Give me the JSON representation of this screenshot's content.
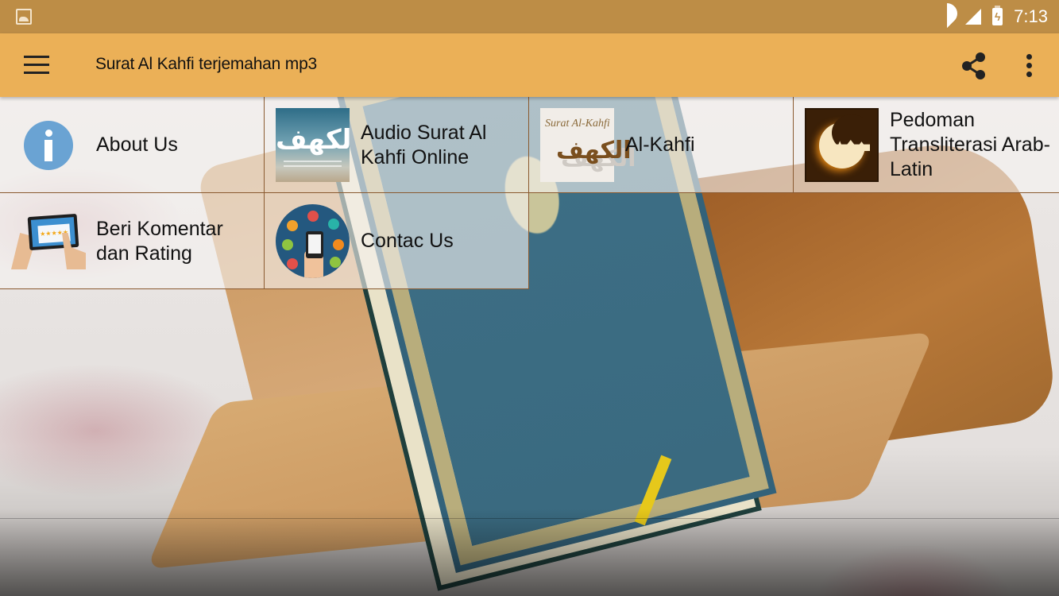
{
  "status_bar": {
    "time": "7:13",
    "icons": [
      "gallery-icon",
      "wifi-icon",
      "signal-icon",
      "battery-charging-icon"
    ]
  },
  "app_bar": {
    "title": "Surat Al Kahfi terjemahan mp3",
    "menu_icon": "hamburger-menu-icon",
    "share_icon": "share-icon",
    "more_icon": "more-vertical-icon"
  },
  "colors": {
    "status_bar": "#bd8d46",
    "app_bar": "#ebb057",
    "tile_border": "#8a5a30",
    "info_icon": "#6aa3d3"
  },
  "menu": {
    "items": [
      {
        "label": "About Us",
        "icon": "info-icon"
      },
      {
        "label": "Audio Surat Al Kahfi Online",
        "icon": "al-kahfi-calligraphy-thumbnail"
      },
      {
        "label": "Al-Kahfi",
        "icon": "surat-al-kahfi-thumbnail",
        "thumb_text": "Surat Al-Kahfi",
        "thumb_arabic": "الكهف"
      },
      {
        "label": "Pedoman Transliterasi Arab-Latin",
        "icon": "crescent-moon-mosque-icon"
      },
      {
        "label": "Beri Komentar dan Rating",
        "icon": "tablet-rating-icon",
        "thumb_stars": "★★★★★"
      },
      {
        "label": "Contac Us",
        "icon": "phone-network-icon"
      }
    ],
    "audio_thumb_arabic": "الكهف"
  },
  "background": {
    "description": "Quran on wooden stand over embroidered cloth"
  }
}
